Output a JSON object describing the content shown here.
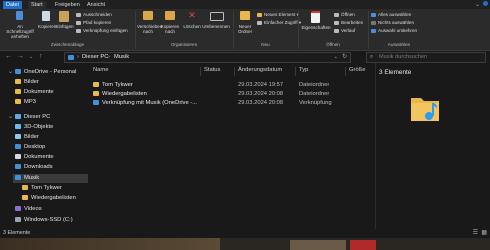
{
  "tabs": [
    "Datei",
    "Start",
    "Freigeben",
    "Ansicht"
  ],
  "ribbon": {
    "pin": "An Schnellzugriff anheften",
    "copy": "Kopieren",
    "paste": "Einfügen",
    "cut": "Ausschneiden",
    "copy_path": "Pfad kopieren",
    "paste_shortcut": "Verknüpfung einfügen",
    "move_to": "Verschieben nach",
    "copy_to": "Kopieren nach",
    "delete": "Löschen",
    "rename": "Umbenennen",
    "new_folder": "Neuer Ordner",
    "new_item": "Neues Element",
    "easy_access": "Einfacher Zugriff",
    "properties": "Eigenschaften",
    "open": "Öffnen",
    "edit": "Bearbeiten",
    "history": "Verlauf",
    "select_all": "Alles auswählen",
    "select_none": "Nichts auswählen",
    "invert": "Auswahl umkehren",
    "groups": [
      "Zwischenablage",
      "Organisieren",
      "Neu",
      "Öffnen",
      "Auswählen"
    ]
  },
  "address": {
    "path": [
      "Dieser PC",
      "Musik"
    ],
    "search_placeholder": "Musik durchsuchen"
  },
  "tree": [
    {
      "label": "OneDrive - Personal",
      "level": 0,
      "icon": "cloud"
    },
    {
      "label": "Bilder",
      "level": 1,
      "icon": "folder"
    },
    {
      "label": "Dokumente",
      "level": 1,
      "icon": "folder"
    },
    {
      "label": "MP3",
      "level": 1,
      "icon": "folder"
    },
    {
      "label": "Dieser PC",
      "level": 0,
      "icon": "pc"
    },
    {
      "label": "3D-Objekte",
      "level": 1,
      "icon": "folder"
    },
    {
      "label": "Bilder",
      "level": 1,
      "icon": "folder"
    },
    {
      "label": "Desktop",
      "level": 1,
      "icon": "folder"
    },
    {
      "label": "Dokumente",
      "level": 1,
      "icon": "folder"
    },
    {
      "label": "Downloads",
      "level": 1,
      "icon": "folder"
    },
    {
      "label": "Musik",
      "level": 1,
      "icon": "music",
      "selected": true
    },
    {
      "label": "Tom Tykwer",
      "level": 2,
      "icon": "folder"
    },
    {
      "label": "Wiedergabelisten",
      "level": 2,
      "icon": "folder"
    },
    {
      "label": "Videos",
      "level": 1,
      "icon": "folder"
    },
    {
      "label": "Windows-SSD (C:)",
      "level": 1,
      "icon": "drive"
    }
  ],
  "columns": [
    "Name",
    "Status",
    "Änderungsdatum",
    "Typ",
    "Größe"
  ],
  "files": [
    {
      "name": "Tom Tykwer",
      "date": "29.03.2024 19:57",
      "type": "Dateiordner"
    },
    {
      "name": "Wiedergabelisten",
      "date": "29.03.2024 20:08",
      "type": "Dateiordner"
    },
    {
      "name": "Verknüpfung mit Musik (OneDrive -...",
      "date": "29.03.2024 20:08",
      "type": "Verknüpfung"
    }
  ],
  "preview": {
    "count_label": "3 Elemente"
  },
  "status": {
    "count_label": "3 Elemente"
  },
  "colors": {
    "folder": "#e8b84a",
    "accent": "#1f6fd1",
    "note": "#2a9df4"
  }
}
